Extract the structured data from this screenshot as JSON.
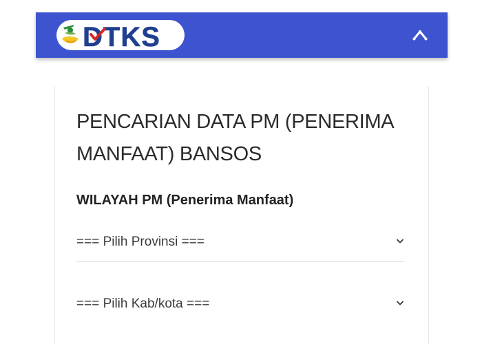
{
  "header": {
    "logo_text": "DTKS",
    "brand_color": "#3d53cf",
    "menu_icon": "chevron-up-icon"
  },
  "form": {
    "title": "PENCARIAN DATA PM (PENERIMA MANFAAT) BANSOS",
    "section_label": "WILAYAH PM (Penerima Manfaat)",
    "provinsi_select": "=== Pilih Provinsi ===",
    "kabkota_select": "=== Pilih Kab/kota ===",
    "select_icon": "chevron-down-icon"
  }
}
